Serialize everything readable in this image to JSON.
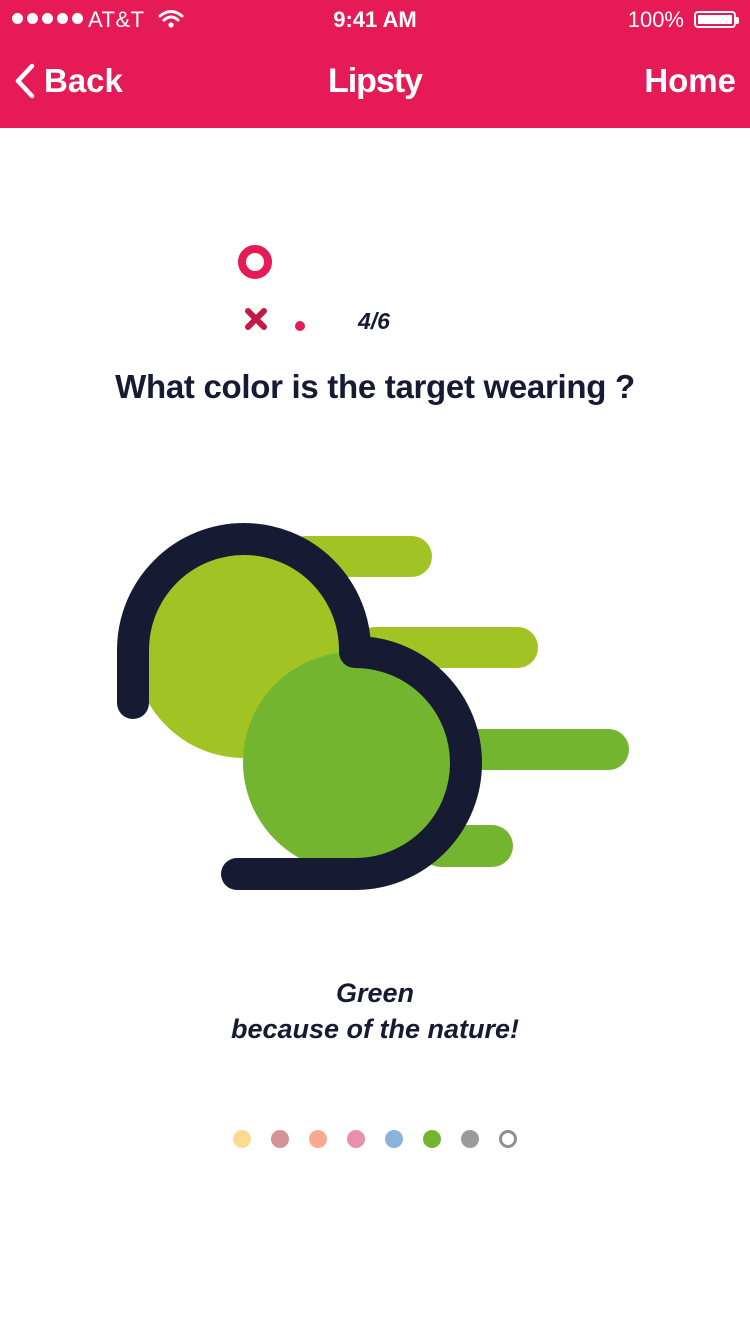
{
  "status_bar": {
    "carrier": "AT&T",
    "time": "9:41 AM",
    "battery": "100%"
  },
  "nav": {
    "back_label": "Back",
    "brand": "Lipsty",
    "home_label": "Home",
    "background_color": "#e51a56"
  },
  "quiz": {
    "progress": "4/6",
    "question": "What color is the target wearing ?",
    "answer_color": "Green",
    "answer_reason": "because of the nature!"
  },
  "illustration": {
    "colors": {
      "outline": "#161a33",
      "light_green": "#a1c424",
      "green": "#74b52f"
    }
  },
  "color_options": [
    {
      "name": "yellow",
      "color": "#fdda91",
      "style": "filled"
    },
    {
      "name": "mauve",
      "color": "#d49295",
      "style": "filled"
    },
    {
      "name": "salmon",
      "color": "#f7aa91",
      "style": "filled"
    },
    {
      "name": "pink",
      "color": "#ea8fae",
      "style": "filled"
    },
    {
      "name": "blue",
      "color": "#8ab3db",
      "style": "filled"
    },
    {
      "name": "green",
      "color": "#74b52f",
      "style": "filled"
    },
    {
      "name": "gray",
      "color": "#9b9b9b",
      "style": "filled"
    },
    {
      "name": "white",
      "color": "#8e8e93",
      "style": "outline"
    }
  ]
}
